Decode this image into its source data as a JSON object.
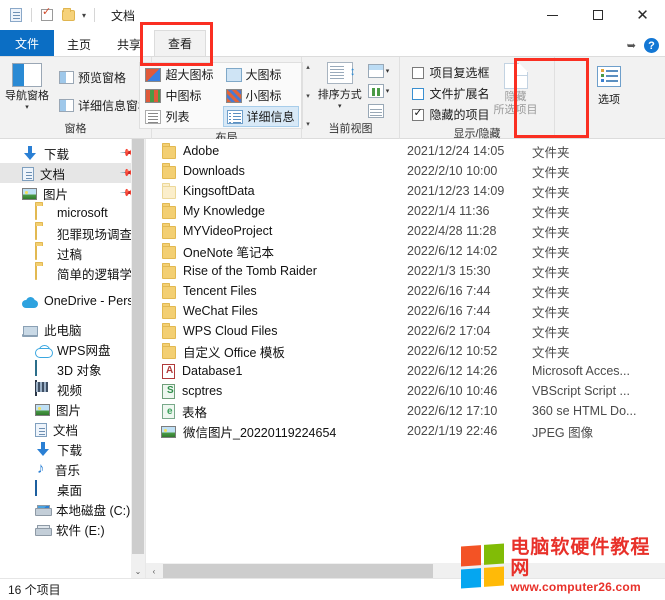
{
  "window": {
    "title": "文档",
    "quick_access": [
      "doc-icon",
      "checklist-icon",
      "folder-icon",
      "dropdown-caret"
    ],
    "controls": {
      "minimize": "—",
      "maximize": "□",
      "close": "✕"
    }
  },
  "tabs": [
    {
      "label": "文件",
      "name": "tab-file"
    },
    {
      "label": "主页",
      "name": "tab-home"
    },
    {
      "label": "共享",
      "name": "tab-share"
    },
    {
      "label": "查看",
      "name": "tab-view",
      "active": true,
      "highlighted": true
    }
  ],
  "tab_right": {
    "pin": "pin-icon",
    "help": "?"
  },
  "ribbon": {
    "groups": [
      {
        "label": "窗格",
        "big_button": {
          "label": "导航窗格",
          "caret": "▾"
        },
        "items": [
          {
            "label": "预览窗格"
          },
          {
            "label": "详细信息窗格"
          }
        ]
      },
      {
        "label": "布局",
        "gallery": [
          {
            "label": "超大图标",
            "icon": "extra-large-icons-icon",
            "selected": false
          },
          {
            "label": "大图标",
            "icon": "large-icons-icon",
            "selected": false
          },
          {
            "label": "中图标",
            "icon": "medium-icons-icon",
            "selected": false
          },
          {
            "label": "小图标",
            "icon": "small-icons-icon",
            "selected": false
          },
          {
            "label": "列表",
            "icon": "list-view-icon",
            "selected": false
          },
          {
            "label": "详细信息",
            "icon": "details-view-icon",
            "selected": true
          }
        ],
        "scroll": {
          "up": "▴",
          "down": "▾",
          "more": "▾"
        }
      },
      {
        "label": "当前视图",
        "sort_button": {
          "label": "排序方式",
          "caret": "▾"
        },
        "mini_buttons": [
          {
            "name": "add-columns-button",
            "caret": "▾"
          },
          {
            "name": "size-all-columns-button",
            "caret": "▾"
          },
          {
            "name": "fit-columns-button",
            "caret": ""
          }
        ]
      },
      {
        "label": "显示/隐藏",
        "checkboxes": [
          {
            "label": "项目复选框",
            "checked": false
          },
          {
            "label": "文件扩展名",
            "checked": false
          },
          {
            "label": "隐藏的项目",
            "checked": true
          }
        ],
        "hide_button": {
          "line1": "隐藏",
          "line2": "所选项目"
        }
      },
      {
        "label": "",
        "options_button": {
          "label": "选项",
          "highlighted": true
        }
      }
    ]
  },
  "nav_pane": {
    "items": [
      {
        "label": "下载",
        "icon": "download-icon",
        "pinned": true,
        "level": 1
      },
      {
        "label": "文档",
        "icon": "document-icon",
        "pinned": true,
        "level": 1,
        "selected": true
      },
      {
        "label": "图片",
        "icon": "pictures-icon",
        "pinned": true,
        "level": 1
      },
      {
        "label": "microsoft",
        "icon": "folder-icon",
        "level": 2
      },
      {
        "label": "犯罪现场调查",
        "icon": "folder-icon",
        "level": 2
      },
      {
        "label": "过稿",
        "icon": "folder-icon",
        "level": 2
      },
      {
        "label": "简单的逻辑学",
        "icon": "folder-icon",
        "level": 2
      },
      {
        "label": "OneDrive - Persc",
        "icon": "onedrive-icon",
        "level": 1,
        "gap_before": true
      },
      {
        "label": "此电脑",
        "icon": "this-pc-icon",
        "level": 1,
        "gap_before": true
      },
      {
        "label": "WPS网盘",
        "icon": "wps-cloud-icon",
        "level": 2
      },
      {
        "label": "3D 对象",
        "icon": "3d-objects-icon",
        "level": 2
      },
      {
        "label": "视频",
        "icon": "videos-icon",
        "level": 2
      },
      {
        "label": "图片",
        "icon": "pictures-icon",
        "level": 2
      },
      {
        "label": "文档",
        "icon": "document-icon",
        "level": 2
      },
      {
        "label": "下载",
        "icon": "download-icon",
        "level": 2
      },
      {
        "label": "音乐",
        "icon": "music-icon",
        "level": 2
      },
      {
        "label": "桌面",
        "icon": "desktop-icon",
        "level": 2
      },
      {
        "label": "本地磁盘 (C:)",
        "icon": "windows-drive-icon",
        "level": 2
      },
      {
        "label": "软件 (E:)",
        "icon": "drive-icon",
        "level": 2
      }
    ],
    "scroll_down": "⌄"
  },
  "file_list": {
    "rows": [
      {
        "name": "Adobe",
        "icon": "folder-icon",
        "date": "2021/12/24 14:05",
        "type": "文件夹"
      },
      {
        "name": "Downloads",
        "icon": "folder-icon",
        "date": "2022/2/10 10:00",
        "type": "文件夹"
      },
      {
        "name": "KingsoftData",
        "icon": "folder-pale-icon",
        "date": "2021/12/23 14:09",
        "type": "文件夹"
      },
      {
        "name": "My Knowledge",
        "icon": "folder-icon",
        "date": "2022/1/4 11:36",
        "type": "文件夹"
      },
      {
        "name": "MYVideoProject",
        "icon": "folder-icon",
        "date": "2022/4/28 11:28",
        "type": "文件夹"
      },
      {
        "name": "OneNote 笔记本",
        "icon": "folder-icon",
        "date": "2022/6/12 14:02",
        "type": "文件夹"
      },
      {
        "name": "Rise of the Tomb Raider",
        "icon": "folder-icon",
        "date": "2022/1/3 15:30",
        "type": "文件夹"
      },
      {
        "name": "Tencent Files",
        "icon": "folder-icon",
        "date": "2022/6/16 7:44",
        "type": "文件夹"
      },
      {
        "name": "WeChat Files",
        "icon": "folder-icon",
        "date": "2022/6/16 7:44",
        "type": "文件夹"
      },
      {
        "name": "WPS Cloud Files",
        "icon": "folder-icon",
        "date": "2022/6/2 17:04",
        "type": "文件夹"
      },
      {
        "name": "自定义 Office 模板",
        "icon": "folder-icon",
        "date": "2022/6/12 10:52",
        "type": "文件夹"
      },
      {
        "name": "Database1",
        "icon": "access-file-icon",
        "date": "2022/6/12 14:26",
        "type": "Microsoft Acces..."
      },
      {
        "name": "scptres",
        "icon": "vbscript-file-icon",
        "date": "2022/6/10 10:46",
        "type": "VBScript Script ..."
      },
      {
        "name": "表格",
        "icon": "html-file-icon",
        "date": "2022/6/12 17:10",
        "type": "360 se HTML Do..."
      },
      {
        "name": "微信图片_20220119224654",
        "icon": "jpeg-file-icon",
        "date": "2022/1/19 22:46",
        "type": "JPEG 图像"
      }
    ],
    "hscroll_left_arrow": "‹"
  },
  "status_bar": {
    "item_count": "16 个项目"
  },
  "watermark": {
    "title": "电脑软硬件教程网",
    "url": "www.computer26.com"
  },
  "colors": {
    "accent": "#0b6ec4",
    "highlight_red": "#fa2f22",
    "ribbon_bg": "#f2f2f2",
    "selection": "#e6e6e6",
    "gallery_selected": "#d8e9f7"
  }
}
